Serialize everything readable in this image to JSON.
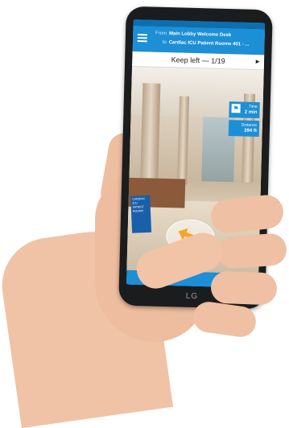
{
  "navigation": {
    "from_label": "From",
    "from_value": "Main Lobby Welcome Desk",
    "to_label": "to",
    "to_value": "Cardiac ICU Patient Rooms 401 - ..."
  },
  "instruction": {
    "text": "Keep left — 1/19",
    "next_symbol": "►"
  },
  "info_panel": {
    "time_label": "Time",
    "time_value": "2 min",
    "distance_label": "Distance",
    "distance_value": "394 ft"
  },
  "wall_sign": {
    "text": "CARDIAC ICU PATIENT ROOMS"
  },
  "device": {
    "brand": "LG"
  },
  "colors": {
    "accent": "#1d8fd6",
    "arrow": "#f5a623"
  },
  "icons": {
    "menu": "hamburger-menu-icon",
    "flag": "finish-flag-icon",
    "direction": "arrow-left-icon"
  }
}
